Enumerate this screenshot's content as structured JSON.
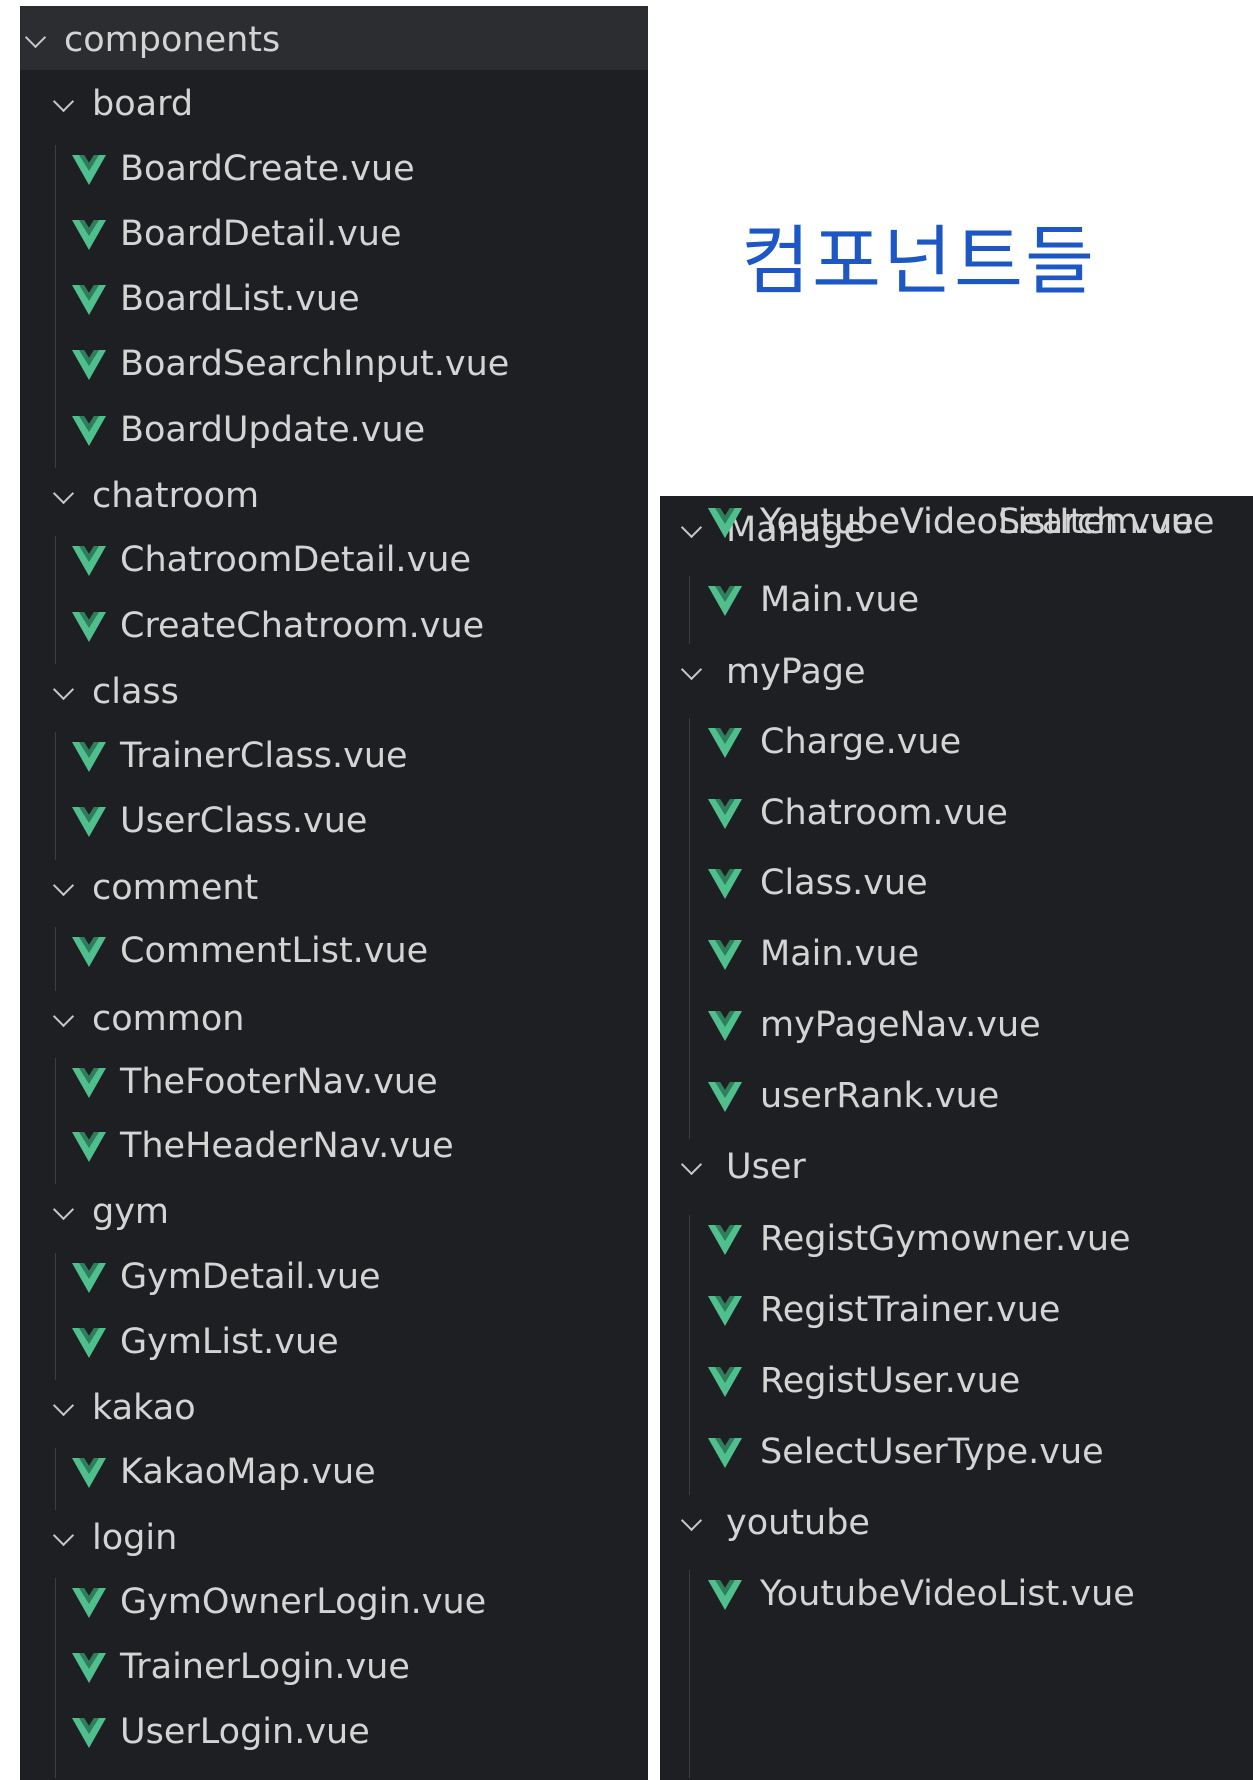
{
  "caption": "컴포넌트들",
  "colors": {
    "panel_bg": "#1e1f22",
    "header_bg": "#2b2d31",
    "text": "#d4d4d4",
    "vue_green": "#4fc08d",
    "caption_blue": "#1d57c4"
  },
  "icons": {
    "folder_toggle": "chevron-down-icon",
    "vue_file": "vue-file-icon"
  },
  "left_tree": [
    {
      "kind": "folder",
      "depth": 0,
      "label": "components"
    },
    {
      "kind": "folder",
      "depth": 1,
      "label": "board"
    },
    {
      "kind": "file",
      "depth": 2,
      "label": "BoardCreate.vue"
    },
    {
      "kind": "file",
      "depth": 2,
      "label": "BoardDetail.vue"
    },
    {
      "kind": "file",
      "depth": 2,
      "label": "BoardList.vue"
    },
    {
      "kind": "file",
      "depth": 2,
      "label": "BoardSearchInput.vue"
    },
    {
      "kind": "file",
      "depth": 2,
      "label": "BoardUpdate.vue"
    },
    {
      "kind": "folder",
      "depth": 1,
      "label": "chatroom"
    },
    {
      "kind": "file",
      "depth": 2,
      "label": "ChatroomDetail.vue"
    },
    {
      "kind": "file",
      "depth": 2,
      "label": "CreateChatroom.vue"
    },
    {
      "kind": "folder",
      "depth": 1,
      "label": "class"
    },
    {
      "kind": "file",
      "depth": 2,
      "label": "TrainerClass.vue"
    },
    {
      "kind": "file",
      "depth": 2,
      "label": "UserClass.vue"
    },
    {
      "kind": "folder",
      "depth": 1,
      "label": "comment"
    },
    {
      "kind": "file",
      "depth": 2,
      "label": "CommentList.vue"
    },
    {
      "kind": "folder",
      "depth": 1,
      "label": "common"
    },
    {
      "kind": "file",
      "depth": 2,
      "label": "TheFooterNav.vue"
    },
    {
      "kind": "file",
      "depth": 2,
      "label": "TheHeaderNav.vue"
    },
    {
      "kind": "folder",
      "depth": 1,
      "label": "gym"
    },
    {
      "kind": "file",
      "depth": 2,
      "label": "GymDetail.vue"
    },
    {
      "kind": "file",
      "depth": 2,
      "label": "GymList.vue"
    },
    {
      "kind": "folder",
      "depth": 1,
      "label": "kakao"
    },
    {
      "kind": "file",
      "depth": 2,
      "label": "KakaoMap.vue"
    },
    {
      "kind": "folder",
      "depth": 1,
      "label": "login"
    },
    {
      "kind": "file",
      "depth": 2,
      "label": "GymOwnerLogin.vue"
    },
    {
      "kind": "file",
      "depth": 2,
      "label": "TrainerLogin.vue"
    },
    {
      "kind": "file",
      "depth": 2,
      "label": "UserLogin.vue"
    }
  ],
  "right_tree": [
    {
      "kind": "folder",
      "depth": 1,
      "label": "Manage"
    },
    {
      "kind": "file",
      "depth": 2,
      "label": "Main.vue"
    },
    {
      "kind": "folder",
      "depth": 1,
      "label": "myPage"
    },
    {
      "kind": "file",
      "depth": 2,
      "label": "Charge.vue"
    },
    {
      "kind": "file",
      "depth": 2,
      "label": "Chatroom.vue"
    },
    {
      "kind": "file",
      "depth": 2,
      "label": "Class.vue"
    },
    {
      "kind": "file",
      "depth": 2,
      "label": "Main.vue"
    },
    {
      "kind": "file",
      "depth": 2,
      "label": "myPageNav.vue"
    },
    {
      "kind": "file",
      "depth": 2,
      "label": "userRank.vue"
    },
    {
      "kind": "folder",
      "depth": 1,
      "label": "User"
    },
    {
      "kind": "file",
      "depth": 2,
      "label": "RegistGymowner.vue"
    },
    {
      "kind": "file",
      "depth": 2,
      "label": "RegistTrainer.vue"
    },
    {
      "kind": "file",
      "depth": 2,
      "label": "RegistUser.vue"
    },
    {
      "kind": "file",
      "depth": 2,
      "label": "SelectUserType.vue"
    },
    {
      "kind": "folder",
      "depth": 1,
      "label": "youtube"
    },
    {
      "kind": "file",
      "depth": 2,
      "label": "YoutubeVideoList.vue"
    },
    {
      "kind": "file",
      "depth": 2,
      "label": "YoutubeVideoListItem.vue"
    },
    {
      "kind": "file",
      "depth": 2,
      "label": "YoutubeVideoSearch.vue"
    }
  ]
}
